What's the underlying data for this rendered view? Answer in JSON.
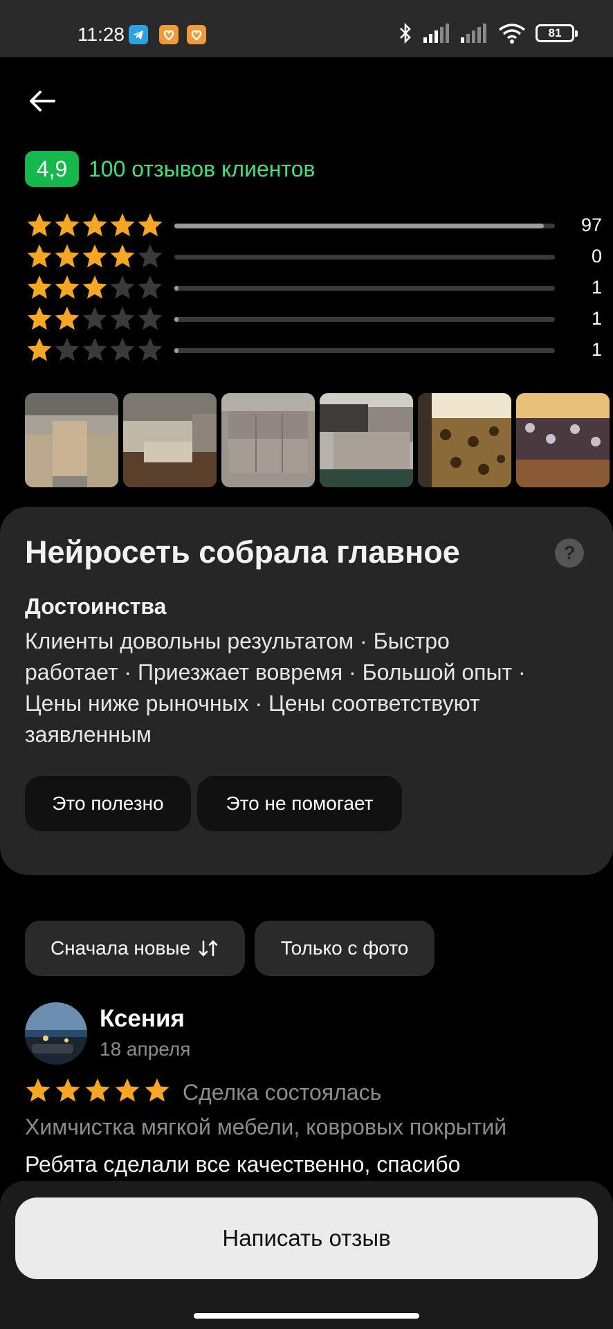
{
  "status_bar": {
    "time": "11:28",
    "battery": "81",
    "app_icons": [
      {
        "name": "telegram-icon",
        "color": "#2aa3e0"
      },
      {
        "name": "app-heart-icon",
        "color": "#f2993a"
      },
      {
        "name": "app-heart-icon-2",
        "color": "#f2993a"
      }
    ]
  },
  "header": {
    "rating": "4,9",
    "reviews_label": "100 отзывов клиентов"
  },
  "rating_breakdown": [
    {
      "stars": 5,
      "count": "97",
      "fill": 0.97
    },
    {
      "stars": 4,
      "count": "0",
      "fill": 0.0
    },
    {
      "stars": 3,
      "count": "1",
      "fill": 0.01
    },
    {
      "stars": 2,
      "count": "1",
      "fill": 0.01
    },
    {
      "stars": 1,
      "count": "1",
      "fill": 0.01
    }
  ],
  "photos": [
    {
      "name": "photo-sofa-1"
    },
    {
      "name": "photo-sofa-2"
    },
    {
      "name": "photo-sofa-3"
    },
    {
      "name": "photo-sofa-4"
    },
    {
      "name": "photo-sofa-5"
    },
    {
      "name": "photo-sofa-6"
    }
  ],
  "ai_summary": {
    "title": "Нейросеть собрала главное",
    "subtitle": "Достоинства",
    "lines": [
      "Клиенты довольны результатом · Быстро",
      "работает · Приезжает вовремя · Большой опыт ·",
      "Цены ниже рыночных · Цены соответствуют",
      "заявленным"
    ],
    "helpful_label": "Это полезно",
    "not_helpful_label": "Это не помогает"
  },
  "filters": {
    "sort_label": "Сначала новые",
    "photo_only_label": "Только с фото"
  },
  "review": {
    "author": "Ксения",
    "date": "18 апреля",
    "rating": 5,
    "deal_status": "Сделка состоялась",
    "service": "Химчистка мягкой мебели, ковровых покрытий",
    "text": "Ребята сделали все качественно, спасибо"
  },
  "bottom": {
    "write_review_label": "Написать отзыв"
  },
  "colors": {
    "accent_green": "#14b84c",
    "link_green": "#3ee07a",
    "star_on": "#f5a623",
    "star_off": "#3a3a3a"
  }
}
